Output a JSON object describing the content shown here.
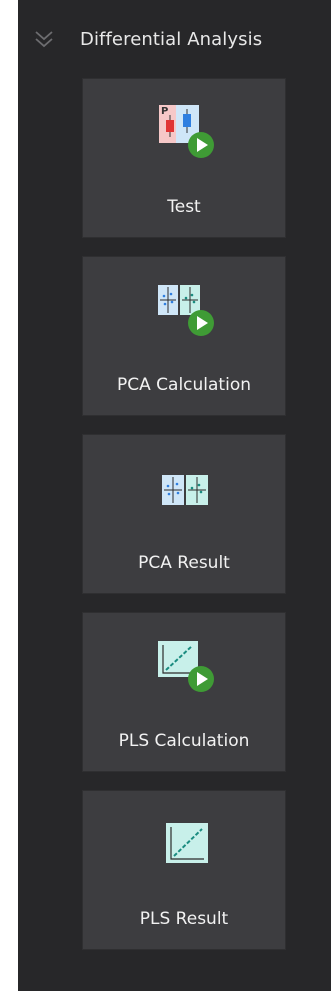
{
  "section": {
    "title": "Differential Analysis",
    "toggle_icon": "double-chevron-down-icon"
  },
  "tiles": [
    {
      "label": "Test",
      "icon": "test-run-icon"
    },
    {
      "label": "PCA Calculation",
      "icon": "pca-calculation-run-icon"
    },
    {
      "label": "PCA Result",
      "icon": "pca-result-icon"
    },
    {
      "label": "PLS Calculation",
      "icon": "pls-calculation-run-icon"
    },
    {
      "label": "PLS Result",
      "icon": "pls-result-icon"
    }
  ],
  "colors": {
    "panel_bg": "#272729",
    "tile_bg": "#3d3d40",
    "text": "#f2f2f2",
    "play_green": "#3f9b35",
    "bar_red": "#e03434",
    "bar_blue": "#2f7fe0",
    "plot_blue": "#cfe6f8",
    "plot_teal": "#c8f0ea"
  }
}
